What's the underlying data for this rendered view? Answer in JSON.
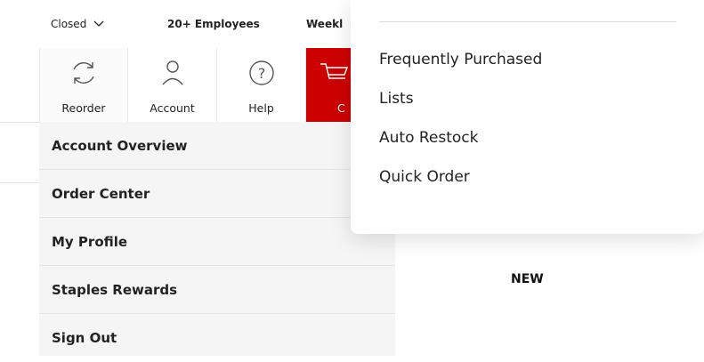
{
  "topbar": {
    "store_status": "Closed",
    "employees": "20+ Employees",
    "weekly": "Weekl"
  },
  "toolbar": {
    "reorder_label": "Reorder",
    "account_label": "Account",
    "help_label": "Help",
    "cart_label": "C",
    "cart_color": "#cc0000"
  },
  "account_menu": {
    "items": [
      {
        "label": "Account Overview"
      },
      {
        "label": "Order Center"
      },
      {
        "label": "My Profile"
      },
      {
        "label": "Staples Rewards"
      },
      {
        "label": "Sign Out"
      }
    ]
  },
  "dropdown": {
    "items": [
      {
        "label": "Frequently Purchased"
      },
      {
        "label": "Lists"
      },
      {
        "label": "Auto Restock"
      },
      {
        "label": "Quick Order"
      }
    ]
  },
  "badge": {
    "new": "NEW"
  },
  "icons": {
    "reorder": "refresh-icon",
    "account": "person-icon",
    "help": "question-circle-icon",
    "cart": "cart-icon",
    "chevron": "chevron-down-icon"
  }
}
